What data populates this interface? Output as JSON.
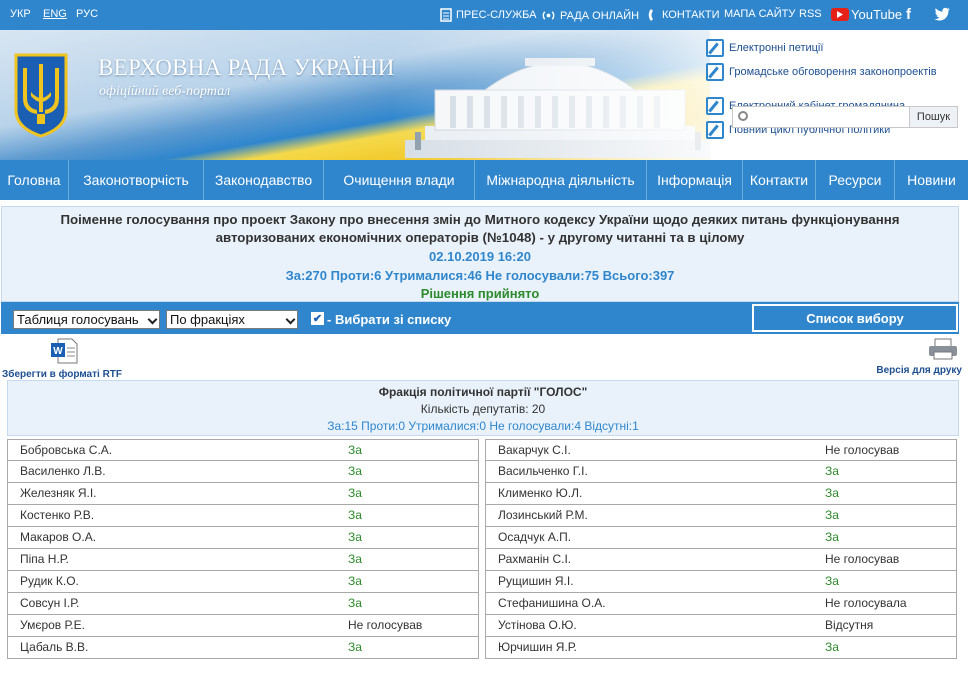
{
  "topbar": {
    "languages": [
      "УКР",
      "ENG",
      "РУС"
    ],
    "press": "ПРЕС-СЛУЖБА",
    "online": "РАДА ОНЛАЙН",
    "contacts": "КОНТАКТИ",
    "sitemap": "МАПА САЙТУ",
    "rss": "RSS",
    "youtube": "YouTube"
  },
  "header": {
    "title": "ВЕРХОВНА РАДА УКРАЇНИ",
    "subtitle": "офіційний веб-портал",
    "links": [
      "Електронні петиції",
      "Громадське обговорення законопроектів",
      "Електронний кабінет громадянина",
      "Повний цикл публічної політики"
    ],
    "search_button": "Пошук"
  },
  "nav": [
    "Головна",
    "Законотворчість",
    "Законодавство",
    "Очищення влади",
    "Міжнародна діяльність",
    "Інформація",
    "Контакти",
    "Ресурси",
    "Новини"
  ],
  "vote": {
    "title": "Поіменне голосування про проект Закону про внесення змін до Митного кодексу України щодо деяких питань функціонування авторизованих економічних операторів (№1048) - у другому читанні та в цілому",
    "datetime": "02.10.2019 16:20",
    "totals": "За:270 Проти:6 Утрималися:46 Не голосували:75 Всього:397",
    "result": "Рішення прийнято"
  },
  "controls": {
    "table_select": "Таблиця голосувань",
    "group_select": "По фракціях",
    "choose_label": "- Вибрати зі списку",
    "list_button": "Список вибору"
  },
  "rtf_label": "Зберегти в форматі RTF",
  "print_label": "Версія для друку",
  "fraction": {
    "name": "Фракція політичної партії \"ГОЛОС\"",
    "count": "Кількість депутатів: 20",
    "totals": "За:15 Проти:0 Утрималися:0 Не голосували:4 Відсутні:1"
  },
  "deputies_left": [
    {
      "name": "Бобровська С.А.",
      "result": "За"
    },
    {
      "name": "Василенко Л.В.",
      "result": "За"
    },
    {
      "name": "Железняк Я.І.",
      "result": "За"
    },
    {
      "name": "Костенко Р.В.",
      "result": "За"
    },
    {
      "name": "Макаров О.А.",
      "result": "За"
    },
    {
      "name": "Піпа Н.Р.",
      "result": "За"
    },
    {
      "name": "Рудик К.О.",
      "result": "За"
    },
    {
      "name": "Совсун І.Р.",
      "result": "За"
    },
    {
      "name": "Умєров Р.Е.",
      "result": "Не голосував"
    },
    {
      "name": "Цабаль В.В.",
      "result": "За"
    }
  ],
  "deputies_right": [
    {
      "name": "Вакарчук С.І.",
      "result": "Не голосував"
    },
    {
      "name": "Васильченко Г.І.",
      "result": "За"
    },
    {
      "name": "Клименко Ю.Л.",
      "result": "За"
    },
    {
      "name": "Лозинський Р.М.",
      "result": "За"
    },
    {
      "name": "Осадчук А.П.",
      "result": "За"
    },
    {
      "name": "Рахманін С.І.",
      "result": "Не голосував"
    },
    {
      "name": "Рущишин Я.І.",
      "result": "За"
    },
    {
      "name": "Стефанишина О.А.",
      "result": "Не голосувала"
    },
    {
      "name": "Устінова О.Ю.",
      "result": "Відсутня"
    },
    {
      "name": "Юрчишин Я.Р.",
      "result": "За"
    }
  ]
}
